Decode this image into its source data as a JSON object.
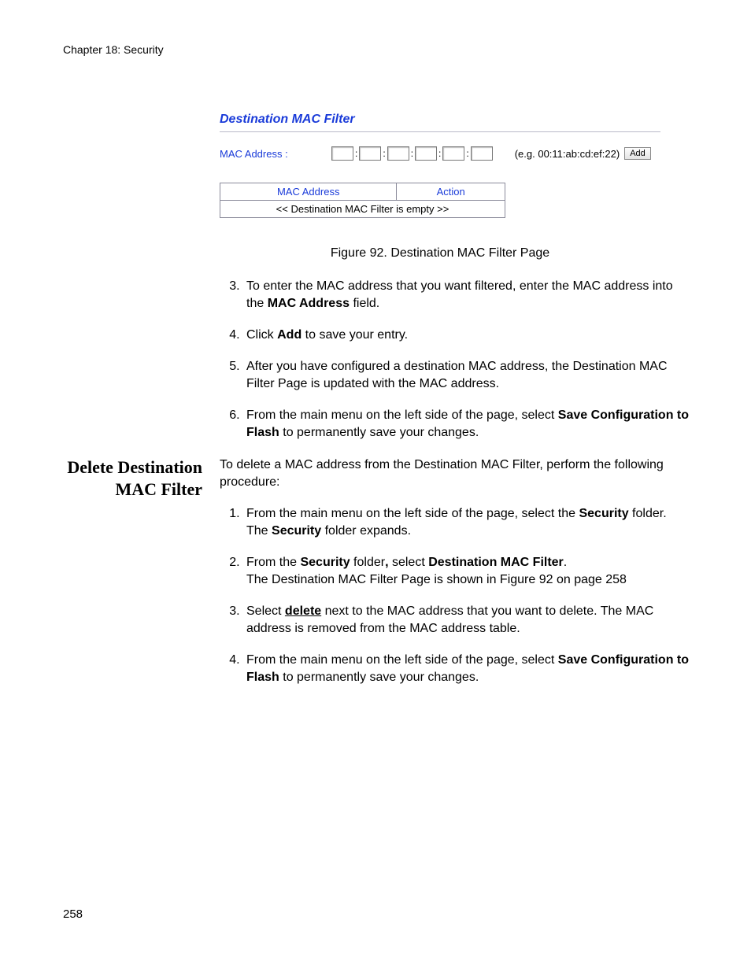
{
  "header": {
    "chapter": "Chapter 18: Security"
  },
  "figure": {
    "panel_title": "Destination MAC Filter",
    "mac_label": "MAC Address :",
    "example": "(e.g. 00:11:ab:cd:ef:22)",
    "add_btn": "Add",
    "table": {
      "col_mac": "MAC Address",
      "col_action": "Action",
      "empty_msg": "<< Destination MAC Filter is empty >>"
    },
    "caption": "Figure 92. Destination MAC Filter Page"
  },
  "steps_a": {
    "s3_a": "To enter the MAC address that you want filtered, enter the MAC address into the ",
    "s3_b": "MAC Address",
    "s3_c": " field.",
    "s4_a": "Click ",
    "s4_b": "Add",
    "s4_c": " to save your entry.",
    "s5": "After you have configured a destination MAC address, the Destination MAC Filter Page is updated with the MAC address.",
    "s6_a": "From the main menu on the left side of the page, select ",
    "s6_b": "Save Configuration to Flash",
    "s6_c": " to permanently save your changes."
  },
  "section": {
    "heading": "Delete Destination MAC Filter",
    "intro": "To delete a MAC address from the Destination MAC Filter, perform the following procedure:",
    "s1_a": "From the main menu on the left side of the page, select the ",
    "s1_b": "Security",
    "s1_c": " folder.",
    "s1_d": "The ",
    "s1_e": "Security",
    "s1_f": " folder expands.",
    "s2_a": "From the ",
    "s2_b": "Security",
    "s2_c": " folder",
    "s2_comma": ",",
    "s2_d": " select ",
    "s2_e": "Destination MAC Filter",
    "s2_f": ".",
    "s2_g": "The Destination MAC Filter Page is shown in Figure 92 on page 258",
    "s3_a": "Select ",
    "s3_b": "delete",
    "s3_c": " next to the MAC address that you want to delete. The MAC address is removed from the MAC address table.",
    "s4_a": "From the main menu on the left side of the page, select ",
    "s4_b": "Save Configuration to Flash",
    "s4_c": " to permanently save your changes."
  },
  "page_number": "258"
}
